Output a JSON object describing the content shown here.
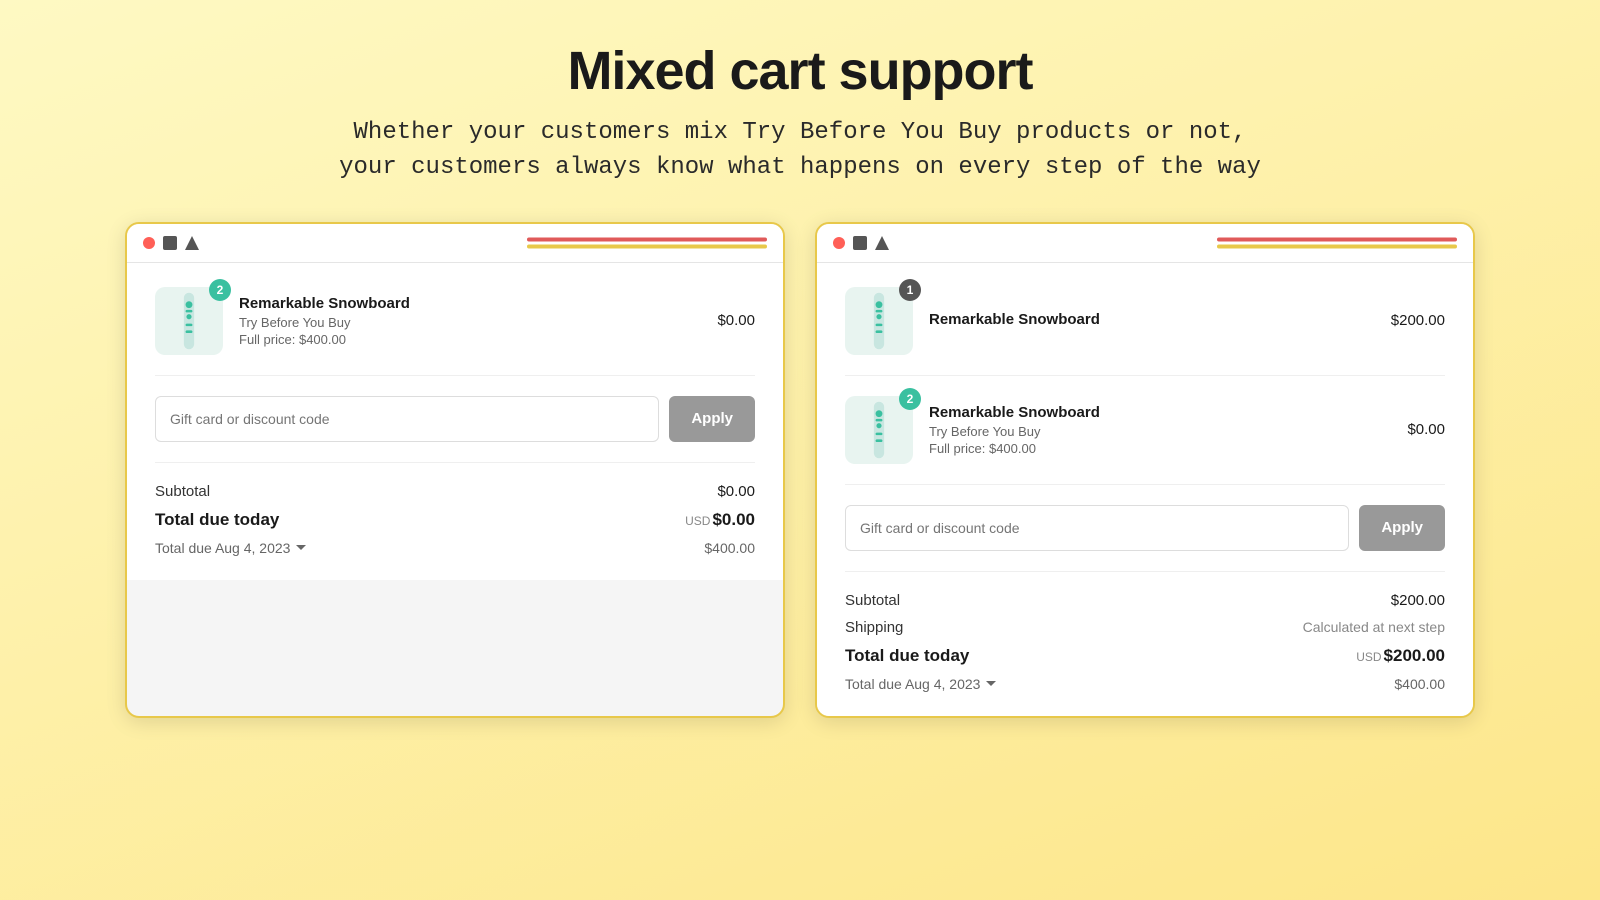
{
  "header": {
    "title": "Mixed cart support",
    "subtitle_line1": "Whether your customers mix Try Before You Buy products or not,",
    "subtitle_line2": "your customers always know what happens on every step of the way"
  },
  "panel_left": {
    "products": [
      {
        "name": "Remarkable Snowboard",
        "tag": "Try Before You Buy",
        "full_price": "Full price: $400.00",
        "price": "$0.00",
        "badge": "2",
        "badge_type": "teal"
      }
    ],
    "discount_placeholder": "Gift card or discount code",
    "apply_label": "Apply",
    "subtotal_label": "Subtotal",
    "subtotal_value": "$0.00",
    "total_today_label": "Total due today",
    "total_today_currency": "USD",
    "total_today_value": "$0.00",
    "due_later_label": "Total due Aug 4, 2023",
    "due_later_value": "$400.00"
  },
  "panel_right": {
    "products": [
      {
        "name": "Remarkable Snowboard",
        "tag": null,
        "full_price": null,
        "price": "$200.00",
        "badge": "1",
        "badge_type": "dark"
      },
      {
        "name": "Remarkable Snowboard",
        "tag": "Try Before You Buy",
        "full_price": "Full price: $400.00",
        "price": "$0.00",
        "badge": "2",
        "badge_type": "teal"
      }
    ],
    "discount_placeholder": "Gift card or discount code",
    "apply_label": "Apply",
    "subtotal_label": "Subtotal",
    "subtotal_value": "$200.00",
    "shipping_label": "Shipping",
    "shipping_value": "Calculated at next step",
    "total_today_label": "Total due today",
    "total_today_currency": "USD",
    "total_today_value": "$200.00",
    "due_later_label": "Total due Aug 4, 2023",
    "due_later_value": "$400.00"
  }
}
